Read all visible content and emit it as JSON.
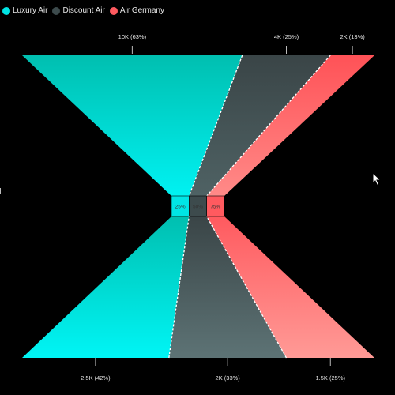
{
  "legend": [
    {
      "label": "Luxury Air",
      "color": "#00E5E5"
    },
    {
      "label": "Discount Air",
      "color": "#3D4B4D"
    },
    {
      "label": "Air Germany",
      "color": "#FF5A5F"
    }
  ],
  "chart_data": {
    "type": "butterfly-funnel",
    "series": [
      "Luxury Air",
      "Discount Air",
      "Air Germany"
    ],
    "colors": {
      "Luxury Air": "#00E5E5",
      "Discount Air": "#3D4B4D",
      "Air Germany": "#FF5A5F"
    },
    "top": {
      "total": 16000,
      "values": [
        10000,
        4000,
        2000
      ],
      "labels": [
        "10K (63%)",
        "4K (25%)",
        "2K (13%)"
      ]
    },
    "bottom": {
      "total": 6000,
      "values": [
        2500,
        2000,
        1500
      ],
      "labels": [
        "2.5K (42%)",
        "2K (33%)",
        "1.5K (25%)"
      ]
    },
    "center": {
      "values": [
        25,
        50,
        75
      ],
      "labels": [
        "25%",
        "50%",
        "75%"
      ]
    },
    "legend_position": "top-left",
    "grid": false
  }
}
